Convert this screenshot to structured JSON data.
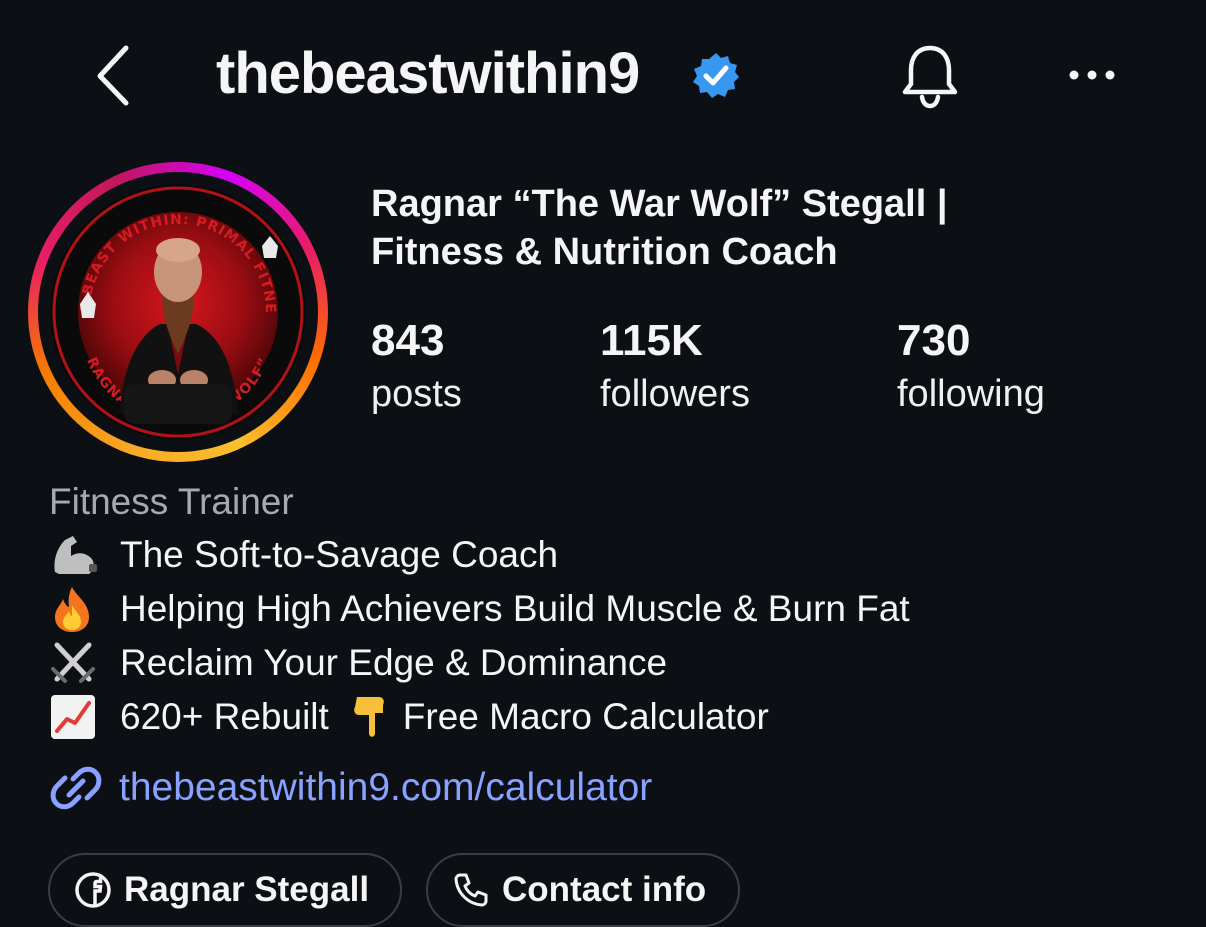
{
  "header": {
    "username": "thebeastwithin9",
    "verified": true
  },
  "profile": {
    "full_name_line1": "Ragnar “The War Wolf” Stegall |",
    "full_name_line2": "Fitness & Nutrition Coach",
    "avatar_badge_text": "THE BEAST WITHIN: PRIMAL FITNESS",
    "avatar_name_text": "RAGNAR “THE WAR WOLF”"
  },
  "stats": {
    "posts": {
      "value": "843",
      "label": "posts"
    },
    "followers": {
      "value": "115K",
      "label": "followers"
    },
    "following": {
      "value": "730",
      "label": "following"
    }
  },
  "bio": {
    "category": "Fitness Trainer",
    "lines": [
      {
        "icon": "flexed-biceps-icon",
        "text": "The Soft-to-Savage Coach"
      },
      {
        "icon": "fire-icon",
        "text": "Helping High Achievers Build Muscle & Burn Fat"
      },
      {
        "icon": "crossed-swords-icon",
        "text": "Reclaim Your Edge & Dominance"
      },
      {
        "icon": "chart-increasing-icon",
        "text": "620+ Rebuilt",
        "icon2": "pointing-down-icon",
        "text2": "Free Macro Calculator"
      }
    ],
    "link": "thebeastwithin9.com/calculator"
  },
  "buttons": {
    "facebook": "Ragnar Stegall",
    "contact": "Contact info"
  },
  "colors": {
    "background": "#0c0f14",
    "verified_blue": "#3897f0",
    "link": "#8aa2ff",
    "category_gray": "#a8a8b0"
  }
}
